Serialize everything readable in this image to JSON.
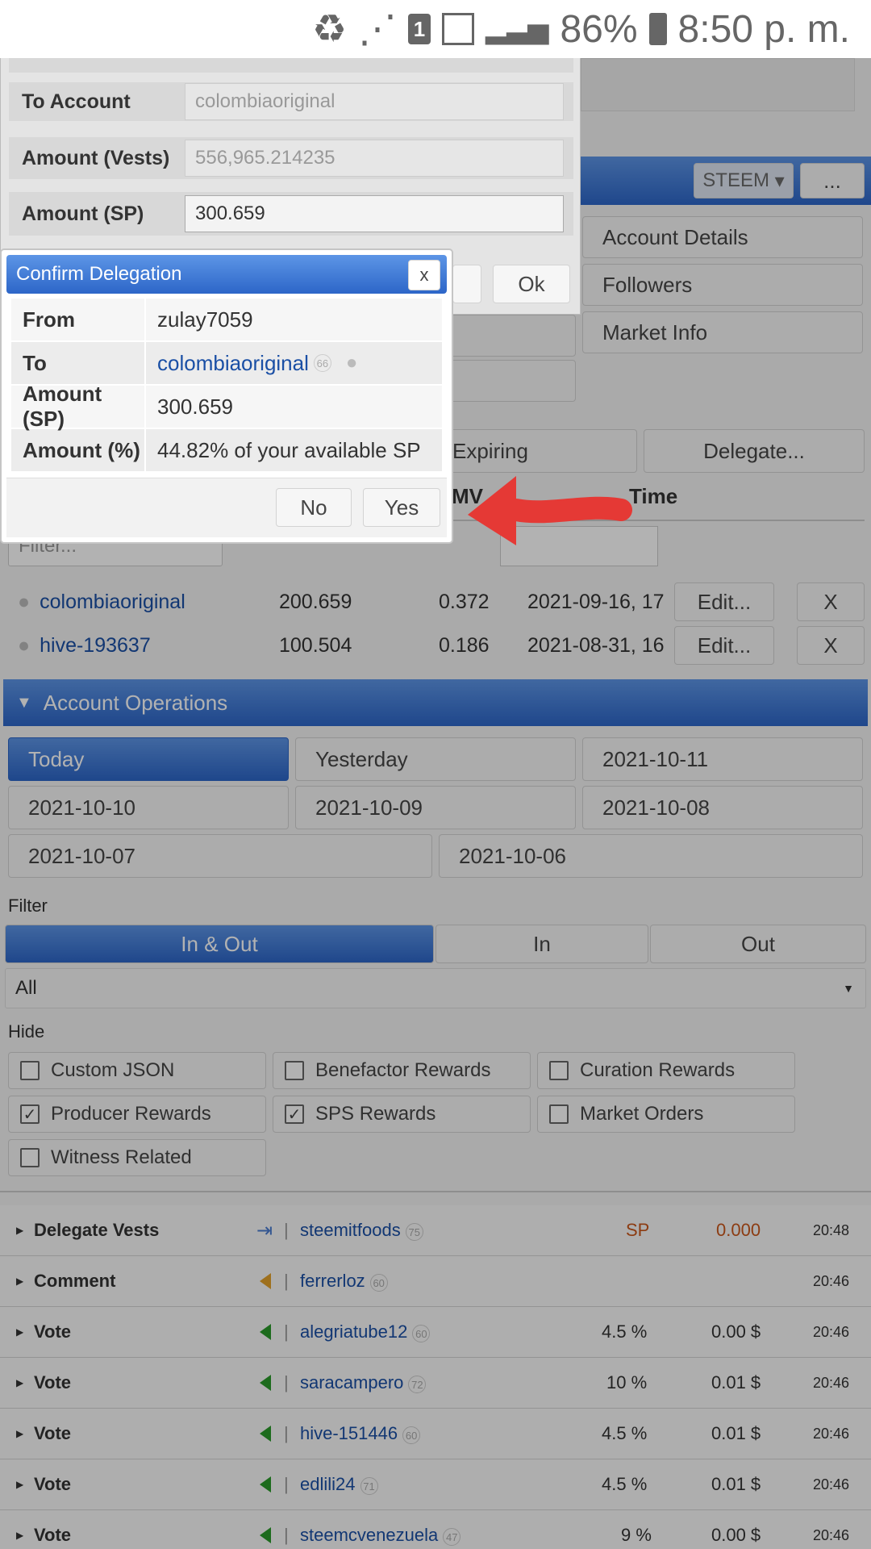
{
  "status": {
    "sim": "1",
    "battery": "86%",
    "time": "8:50 p. m."
  },
  "delegate_form": {
    "to_account_label": "To Account",
    "to_account_value": "colombiaoriginal",
    "vests_label": "Amount (Vests)",
    "vests_value": "556,965.214235",
    "sp_label": "Amount (SP)",
    "sp_value": "300.659",
    "ok": "Ok"
  },
  "header": {
    "steem": "STEEM",
    "more": "..."
  },
  "side_menu": [
    "Account Details",
    "Followers",
    "Market Info"
  ],
  "tabs": {
    "expiring": "Expiring",
    "delegate": "Delegate..."
  },
  "table_headers": {
    "mv": "MV",
    "time": "Time"
  },
  "filter_placeholder": "Filter...",
  "delegations": [
    {
      "account": "colombiaoriginal",
      "sp": "200.659",
      "mv": "0.372",
      "time": "2021-09-16, 17:",
      "edit": "Edit...",
      "x": "X"
    },
    {
      "account": "hive-193637",
      "sp": "100.504",
      "mv": "0.186",
      "time": "2021-08-31, 16:",
      "edit": "Edit...",
      "x": "X"
    }
  ],
  "operations": {
    "title": "Account Operations",
    "dates": [
      "Today",
      "Yesterday",
      "2021-10-11",
      "2021-10-10",
      "2021-10-09",
      "2021-10-08",
      "2021-10-07",
      "2021-10-06"
    ],
    "filter_label": "Filter",
    "filters": [
      "In & Out",
      "In",
      "Out"
    ],
    "select": "All",
    "hide_label": "Hide",
    "hide_opts": [
      "Custom JSON",
      "Benefactor Rewards",
      "Curation Rewards",
      "Producer Rewards",
      "SPS Rewards",
      "Market Orders",
      "Witness Related"
    ]
  },
  "ops": [
    {
      "type": "Delegate Vests",
      "user": "steemitfoods",
      "rep": "75",
      "a": "SP",
      "b": "0.000",
      "time": "20:48"
    },
    {
      "type": "Comment",
      "user": "ferrerloz",
      "rep": "60",
      "a": "",
      "b": "",
      "time": "20:46"
    },
    {
      "type": "Vote",
      "user": "alegriatube12",
      "rep": "60",
      "a": "4.5 %",
      "b": "0.00 $",
      "time": "20:46"
    },
    {
      "type": "Vote",
      "user": "saracampero",
      "rep": "72",
      "a": "10 %",
      "b": "0.01 $",
      "time": "20:46"
    },
    {
      "type": "Vote",
      "user": "hive-151446",
      "rep": "60",
      "a": "4.5 %",
      "b": "0.01 $",
      "time": "20:46"
    },
    {
      "type": "Vote",
      "user": "edlili24",
      "rep": "71",
      "a": "4.5 %",
      "b": "0.01 $",
      "time": "20:46"
    },
    {
      "type": "Vote",
      "user": "steemcvenezuela",
      "rep": "47",
      "a": "9 %",
      "b": "0.00 $",
      "time": "20:46"
    }
  ],
  "confirm": {
    "title": "Confirm Delegation",
    "close": "x",
    "from_label": "From",
    "from": "zulay7059",
    "to_label": "To",
    "to": "colombiaoriginal",
    "to_rep": "66",
    "sp_label": "Amount (SP)",
    "sp": "300.659",
    "pct_label": "Amount (%)",
    "pct": "44.82% of your available SP",
    "no": "No",
    "yes": "Yes"
  }
}
